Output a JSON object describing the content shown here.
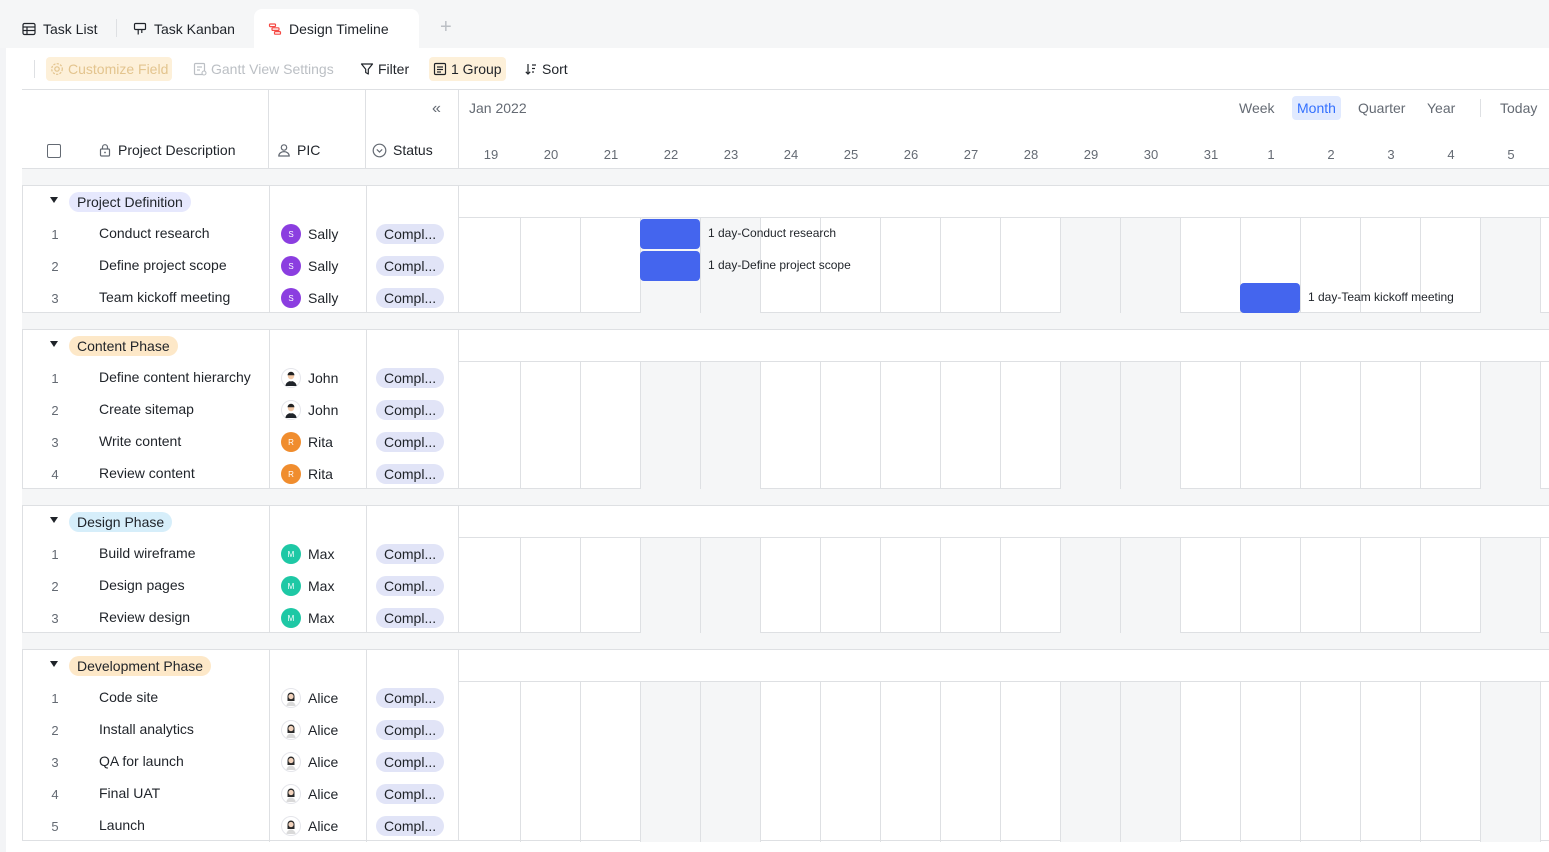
{
  "tabs": [
    {
      "label": "Task List",
      "icon": "table-icon"
    },
    {
      "label": "Task Kanban",
      "icon": "kanban-icon"
    },
    {
      "label": "Design Timeline",
      "icon": "gantt-icon",
      "active": true
    }
  ],
  "toolbar": {
    "customize_field": "Customize Field",
    "gantt_settings": "Gantt View Settings",
    "filter": "Filter",
    "group": "1 Group",
    "sort": "Sort"
  },
  "columns": {
    "description": "Project Description",
    "pic": "PIC",
    "status": "Status"
  },
  "timeline": {
    "month": "Jan 2022",
    "zoom": [
      "Week",
      "Month",
      "Quarter",
      "Year"
    ],
    "zoom_active": "Month",
    "today": "Today",
    "days": [
      "19",
      "20",
      "21",
      "22",
      "23",
      "24",
      "25",
      "26",
      "27",
      "28",
      "29",
      "30",
      "31",
      "1",
      "2",
      "3",
      "4",
      "5"
    ]
  },
  "colors": {
    "bar": "#4465ee",
    "status_bg": "#e1e4f7",
    "sally": "#8b3ee0",
    "rita": "#f08d2e",
    "max": "#1ec8a5"
  },
  "groups": [
    {
      "name": "Project Definition",
      "tag_color": "#e6e8fd",
      "rows": [
        {
          "num": "1",
          "name": "Conduct research",
          "pic": "Sally",
          "av": "S",
          "status": "Compl...",
          "bar_day": 3,
          "bar_label": "1 day-Conduct research"
        },
        {
          "num": "2",
          "name": "Define project scope",
          "pic": "Sally",
          "av": "S",
          "status": "Compl...",
          "bar_day": 3,
          "bar_label": "1 day-Define project scope"
        },
        {
          "num": "3",
          "name": "Team kickoff meeting",
          "pic": "Sally",
          "av": "S",
          "status": "Compl...",
          "bar_day": 13,
          "bar_label": "1 day-Team kickoff meeting"
        }
      ]
    },
    {
      "name": "Content Phase",
      "tag_color": "#fde8c8",
      "rows": [
        {
          "num": "1",
          "name": "Define content hierarchy",
          "pic": "John",
          "av": "",
          "status": "Compl..."
        },
        {
          "num": "2",
          "name": "Create sitemap",
          "pic": "John",
          "av": "",
          "status": "Compl..."
        },
        {
          "num": "3",
          "name": "Write content",
          "pic": "Rita",
          "av": "R",
          "status": "Compl..."
        },
        {
          "num": "4",
          "name": "Review content",
          "pic": "Rita",
          "av": "R",
          "status": "Compl..."
        }
      ]
    },
    {
      "name": "Design Phase",
      "tag_color": "#d6eefa",
      "rows": [
        {
          "num": "1",
          "name": "Build wireframe",
          "pic": "Max",
          "av": "M",
          "status": "Compl..."
        },
        {
          "num": "2",
          "name": "Design pages",
          "pic": "Max",
          "av": "M",
          "status": "Compl..."
        },
        {
          "num": "3",
          "name": "Review design",
          "pic": "Max",
          "av": "M",
          "status": "Compl..."
        }
      ]
    },
    {
      "name": "Development Phase",
      "tag_color": "#fde8c8",
      "rows": [
        {
          "num": "1",
          "name": "Code site",
          "pic": "Alice",
          "av": "",
          "status": "Compl..."
        },
        {
          "num": "2",
          "name": "Install analytics",
          "pic": "Alice",
          "av": "",
          "status": "Compl..."
        },
        {
          "num": "3",
          "name": "QA for launch",
          "pic": "Alice",
          "av": "",
          "status": "Compl..."
        },
        {
          "num": "4",
          "name": "Final UAT",
          "pic": "Alice",
          "av": "",
          "status": "Compl..."
        },
        {
          "num": "5",
          "name": "Launch",
          "pic": "Alice",
          "av": "",
          "status": "Compl..."
        }
      ]
    }
  ]
}
